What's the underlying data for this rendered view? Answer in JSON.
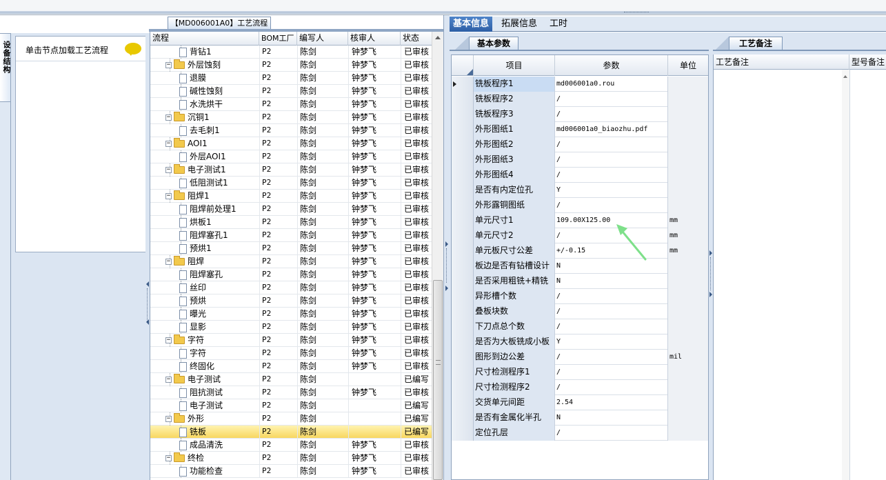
{
  "process_panel": {
    "title": "【MD006001A0】工艺流程",
    "hint": "单击节点加载工艺流程",
    "side_tab": "设备结构",
    "columns": [
      "流程",
      "BOM工厂",
      "编写人",
      "核审人",
      "状态"
    ],
    "rows": [
      {
        "name": "背钻1",
        "level": 1,
        "type": "doc",
        "bom": "P2",
        "writer": "陈剑",
        "reviewer": "钟梦飞",
        "status": "已审核"
      },
      {
        "name": "外层蚀刻",
        "level": 0,
        "type": "folder",
        "bom": "P2",
        "writer": "陈剑",
        "reviewer": "钟梦飞",
        "status": "已审核"
      },
      {
        "name": "退膜",
        "level": 1,
        "type": "doc",
        "bom": "P2",
        "writer": "陈剑",
        "reviewer": "钟梦飞",
        "status": "已审核"
      },
      {
        "name": "碱性蚀刻",
        "level": 1,
        "type": "doc",
        "bom": "P2",
        "writer": "陈剑",
        "reviewer": "钟梦飞",
        "status": "已审核"
      },
      {
        "name": "水洗烘干",
        "level": 1,
        "type": "doc",
        "bom": "P2",
        "writer": "陈剑",
        "reviewer": "钟梦飞",
        "status": "已审核"
      },
      {
        "name": "沉铜1",
        "level": 0,
        "type": "folder",
        "bom": "P2",
        "writer": "陈剑",
        "reviewer": "钟梦飞",
        "status": "已审核"
      },
      {
        "name": "去毛刺1",
        "level": 1,
        "type": "doc",
        "bom": "P2",
        "writer": "陈剑",
        "reviewer": "钟梦飞",
        "status": "已审核"
      },
      {
        "name": "AOI1",
        "level": 0,
        "type": "folder",
        "bom": "P2",
        "writer": "陈剑",
        "reviewer": "钟梦飞",
        "status": "已审核"
      },
      {
        "name": "外层AOI1",
        "level": 1,
        "type": "doc",
        "bom": "P2",
        "writer": "陈剑",
        "reviewer": "钟梦飞",
        "status": "已审核"
      },
      {
        "name": "电子测试1",
        "level": 0,
        "type": "folder",
        "bom": "P2",
        "writer": "陈剑",
        "reviewer": "钟梦飞",
        "status": "已审核"
      },
      {
        "name": "低阻测试1",
        "level": 1,
        "type": "doc",
        "bom": "P2",
        "writer": "陈剑",
        "reviewer": "钟梦飞",
        "status": "已审核"
      },
      {
        "name": "阻焊1",
        "level": 0,
        "type": "folder",
        "bom": "P2",
        "writer": "陈剑",
        "reviewer": "钟梦飞",
        "status": "已审核"
      },
      {
        "name": "阻焊前处理1",
        "level": 1,
        "type": "doc",
        "bom": "P2",
        "writer": "陈剑",
        "reviewer": "钟梦飞",
        "status": "已审核"
      },
      {
        "name": "烘板1",
        "level": 1,
        "type": "doc",
        "bom": "P2",
        "writer": "陈剑",
        "reviewer": "钟梦飞",
        "status": "已审核"
      },
      {
        "name": "阻焊塞孔1",
        "level": 1,
        "type": "doc",
        "bom": "P2",
        "writer": "陈剑",
        "reviewer": "钟梦飞",
        "status": "已审核"
      },
      {
        "name": "预烘1",
        "level": 1,
        "type": "doc",
        "bom": "P2",
        "writer": "陈剑",
        "reviewer": "钟梦飞",
        "status": "已审核"
      },
      {
        "name": "阻焊",
        "level": 0,
        "type": "folder",
        "bom": "P2",
        "writer": "陈剑",
        "reviewer": "钟梦飞",
        "status": "已审核"
      },
      {
        "name": "阻焊塞孔",
        "level": 1,
        "type": "doc",
        "bom": "P2",
        "writer": "陈剑",
        "reviewer": "钟梦飞",
        "status": "已审核"
      },
      {
        "name": "丝印",
        "level": 1,
        "type": "doc",
        "bom": "P2",
        "writer": "陈剑",
        "reviewer": "钟梦飞",
        "status": "已审核"
      },
      {
        "name": "预烘",
        "level": 1,
        "type": "doc",
        "bom": "P2",
        "writer": "陈剑",
        "reviewer": "钟梦飞",
        "status": "已审核"
      },
      {
        "name": "曝光",
        "level": 1,
        "type": "doc",
        "bom": "P2",
        "writer": "陈剑",
        "reviewer": "钟梦飞",
        "status": "已审核"
      },
      {
        "name": "显影",
        "level": 1,
        "type": "doc",
        "bom": "P2",
        "writer": "陈剑",
        "reviewer": "钟梦飞",
        "status": "已审核"
      },
      {
        "name": "字符",
        "level": 0,
        "type": "folder",
        "bom": "P2",
        "writer": "陈剑",
        "reviewer": "钟梦飞",
        "status": "已审核"
      },
      {
        "name": "字符",
        "level": 1,
        "type": "doc",
        "bom": "P2",
        "writer": "陈剑",
        "reviewer": "钟梦飞",
        "status": "已审核"
      },
      {
        "name": "终固化",
        "level": 1,
        "type": "doc",
        "bom": "P2",
        "writer": "陈剑",
        "reviewer": "钟梦飞",
        "status": "已审核"
      },
      {
        "name": "电子测试",
        "level": 0,
        "type": "folder",
        "bom": "P2",
        "writer": "陈剑",
        "reviewer": "",
        "status": "已编写"
      },
      {
        "name": "阻抗测试",
        "level": 1,
        "type": "doc",
        "bom": "P2",
        "writer": "陈剑",
        "reviewer": "钟梦飞",
        "status": "已审核"
      },
      {
        "name": "电子测试",
        "level": 1,
        "type": "doc",
        "bom": "P2",
        "writer": "陈剑",
        "reviewer": "",
        "status": "已编写"
      },
      {
        "name": "外形",
        "level": 0,
        "type": "folder",
        "bom": "P2",
        "writer": "陈剑",
        "reviewer": "",
        "status": "已编写"
      },
      {
        "name": "铣板",
        "level": 1,
        "type": "doc",
        "bom": "P2",
        "writer": "陈剑",
        "reviewer": "",
        "status": "已编写",
        "selected": true
      },
      {
        "name": "成品清洗",
        "level": 1,
        "type": "doc",
        "bom": "P2",
        "writer": "陈剑",
        "reviewer": "钟梦飞",
        "status": "已审核"
      },
      {
        "name": "终检",
        "level": 0,
        "type": "folder",
        "bom": "P2",
        "writer": "陈剑",
        "reviewer": "钟梦飞",
        "status": "已审核"
      },
      {
        "name": "功能检查",
        "level": 1,
        "type": "doc",
        "bom": "P2",
        "writer": "陈剑",
        "reviewer": "钟梦飞",
        "status": "已审核"
      }
    ]
  },
  "main_tabs": [
    "基本信息",
    "拓展信息",
    "工时"
  ],
  "basic_params": {
    "tab": "基本参数",
    "columns": [
      "项目",
      "参数",
      "单位"
    ],
    "rows": [
      {
        "item": "铣板程序1",
        "param": "md006001a0.rou",
        "unit": "",
        "current": true
      },
      {
        "item": "铣板程序2",
        "param": "/",
        "unit": ""
      },
      {
        "item": "铣板程序3",
        "param": "/",
        "unit": ""
      },
      {
        "item": "外形图纸1",
        "param": "md006001a0_biaozhu.pdf",
        "unit": ""
      },
      {
        "item": "外形图纸2",
        "param": "/",
        "unit": ""
      },
      {
        "item": "外形图纸3",
        "param": "/",
        "unit": ""
      },
      {
        "item": "外形图纸4",
        "param": "/",
        "unit": ""
      },
      {
        "item": "是否有内定位孔",
        "param": "Y",
        "unit": ""
      },
      {
        "item": "外形露铜图纸",
        "param": "/",
        "unit": ""
      },
      {
        "item": "单元尺寸1",
        "param": "109.00X125.00",
        "unit": "mm"
      },
      {
        "item": "单元尺寸2",
        "param": "/",
        "unit": "mm"
      },
      {
        "item": "单元板尺寸公差",
        "param": "+/-0.15",
        "unit": "mm"
      },
      {
        "item": "板边是否有钻槽设计",
        "param": "N",
        "unit": ""
      },
      {
        "item": "是否采用粗铣+精铣",
        "param": "N",
        "unit": ""
      },
      {
        "item": "异形槽个数",
        "param": "/",
        "unit": ""
      },
      {
        "item": "叠板块数",
        "param": "/",
        "unit": ""
      },
      {
        "item": "下刀点总个数",
        "param": "/",
        "unit": ""
      },
      {
        "item": "是否为大板铣成小板",
        "param": "Y",
        "unit": ""
      },
      {
        "item": "图形到边公差",
        "param": "/",
        "unit": "mil"
      },
      {
        "item": "尺寸检测程序1",
        "param": "/",
        "unit": ""
      },
      {
        "item": "尺寸检测程序2",
        "param": "/",
        "unit": ""
      },
      {
        "item": "交货单元间距",
        "param": "2.54",
        "unit": ""
      },
      {
        "item": "是否有金属化半孔",
        "param": "N",
        "unit": ""
      },
      {
        "item": "定位孔层",
        "param": "/",
        "unit": ""
      }
    ]
  },
  "notes_panel": {
    "tab": "工艺备注",
    "columns": [
      "工艺备注",
      "型号备注"
    ]
  },
  "colors": {
    "accent": "#2d5fa6",
    "selected_row": "#f8d760",
    "annotation_arrow": "#7ee08a"
  }
}
